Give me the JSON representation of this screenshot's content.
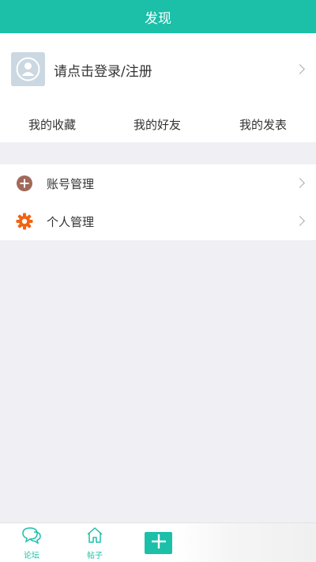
{
  "header": {
    "title": "发现"
  },
  "profile": {
    "login_text": "请点击登录/注册"
  },
  "quick_links": [
    {
      "label": "我的收藏"
    },
    {
      "label": "我的好友"
    },
    {
      "label": "我的发表"
    }
  ],
  "menu": [
    {
      "label": "账号管理",
      "icon": "plus-circle-icon",
      "color": "#a0695a"
    },
    {
      "label": "个人管理",
      "icon": "gear-icon",
      "color": "#f2640f"
    }
  ],
  "tabbar": {
    "tabs": [
      {
        "label": "论坛",
        "icon": "chat-bubble-icon"
      },
      {
        "label": "帖子",
        "icon": "home-icon"
      }
    ],
    "add_icon": "plus-icon",
    "accent_color": "#1cbfa8"
  }
}
